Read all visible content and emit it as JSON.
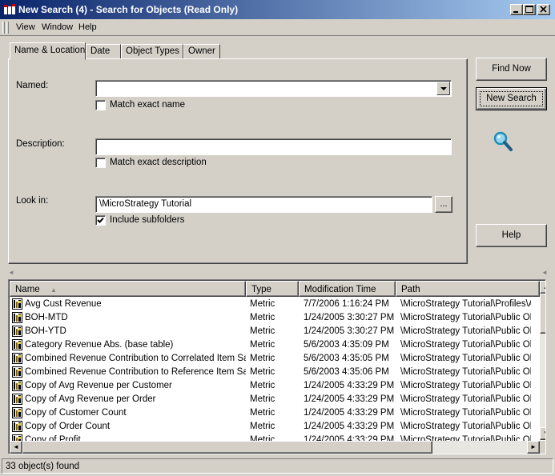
{
  "window": {
    "title": "New Search (4) - Search for Objects (Read Only)",
    "minimize": "_",
    "maximize": "□",
    "close": "✕"
  },
  "menu": [
    {
      "label": "View"
    },
    {
      "label": "Window"
    },
    {
      "label": "Help"
    }
  ],
  "tabs": [
    {
      "label": "Name & Location",
      "active": true
    },
    {
      "label": "Date"
    },
    {
      "label": "Object Types"
    },
    {
      "label": "Owner"
    }
  ],
  "form": {
    "named_label": "Named:",
    "named_value": "",
    "match_exact_name_label": "Match exact name",
    "match_exact_name_checked": false,
    "description_label": "Description:",
    "description_value": "",
    "match_exact_description_label": "Match exact description",
    "match_exact_description_checked": false,
    "look_in_label": "Look in:",
    "look_in_value": "\\MicroStrategy Tutorial",
    "browse_label": "...",
    "include_subfolders_label": "Include subfolders",
    "include_subfolders_checked": true
  },
  "buttons": {
    "find_now": "Find Now",
    "new_search": "New Search",
    "help": "Help"
  },
  "results": {
    "columns": [
      "Name",
      "Type",
      "Modification Time",
      "Path"
    ],
    "sort_column": "Name",
    "rows": [
      {
        "name": "Avg Cust Revenue",
        "type": "Metric",
        "modified": "7/7/2006 1:16:24 PM",
        "path": "\\MicroStrategy Tutorial\\Profiles\\Ad"
      },
      {
        "name": "BOH-MTD",
        "type": "Metric",
        "modified": "1/24/2005 3:30:27 PM",
        "path": "\\MicroStrategy Tutorial\\Public Obj"
      },
      {
        "name": "BOH-YTD",
        "type": "Metric",
        "modified": "1/24/2005 3:30:27 PM",
        "path": "\\MicroStrategy Tutorial\\Public Obj"
      },
      {
        "name": "Category Revenue Abs. (base table)",
        "type": "Metric",
        "modified": "5/6/2003 4:35:09 PM",
        "path": "\\MicroStrategy Tutorial\\Public Obj"
      },
      {
        "name": "Combined Revenue Contribution to Correlated Item Sales",
        "type": "Metric",
        "modified": "5/6/2003 4:35:05 PM",
        "path": "\\MicroStrategy Tutorial\\Public Obj"
      },
      {
        "name": "Combined Revenue Contribution to Reference Item Sales",
        "type": "Metric",
        "modified": "5/6/2003 4:35:06 PM",
        "path": "\\MicroStrategy Tutorial\\Public Obj"
      },
      {
        "name": "Copy of Avg Revenue per Customer",
        "type": "Metric",
        "modified": "1/24/2005 4:33:29 PM",
        "path": "\\MicroStrategy Tutorial\\Public Obj"
      },
      {
        "name": "Copy of Avg Revenue per Order",
        "type": "Metric",
        "modified": "1/24/2005 4:33:29 PM",
        "path": "\\MicroStrategy Tutorial\\Public Obj"
      },
      {
        "name": "Copy of Customer Count",
        "type": "Metric",
        "modified": "1/24/2005 4:33:29 PM",
        "path": "\\MicroStrategy Tutorial\\Public Obj"
      },
      {
        "name": "Copy of Order Count",
        "type": "Metric",
        "modified": "1/24/2005 4:33:29 PM",
        "path": "\\MicroStrategy Tutorial\\Public Obj"
      },
      {
        "name": "Copy of Profit",
        "type": "Metric",
        "modified": "1/24/2005 4:33:29 PM",
        "path": "\\MicroStrategy Tutorial\\Public Obj"
      }
    ]
  },
  "status": {
    "text": "33 object(s) found"
  },
  "colors": {
    "title_gradient_start": "#0a246a",
    "title_gradient_end": "#a6caf0",
    "face": "#d4d0c8",
    "magnifier": "#1e8fb8"
  },
  "icons": {
    "app": "app-icon",
    "search": "magnifier-icon",
    "row": "metric-icon",
    "dropdown": "chevron-down-icon"
  }
}
